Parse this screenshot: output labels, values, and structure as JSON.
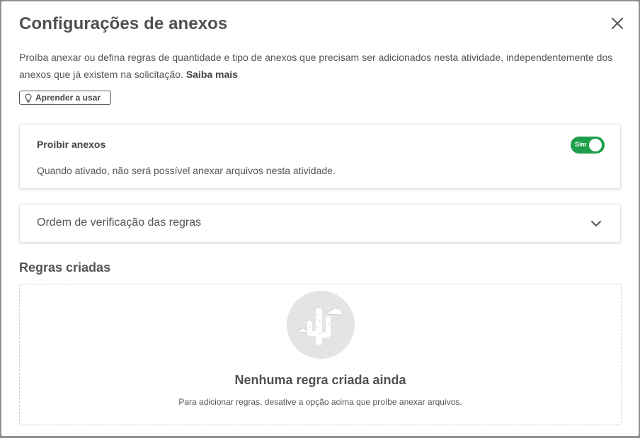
{
  "modal": {
    "title": "Configurações de anexos",
    "description": "Proíba anexar ou defina regras de quantidade e tipo de anexos que precisam ser adicionados nesta atividade, independentemente dos anexos que já existem na solicitação.",
    "learn_more_link": "Saiba mais",
    "learn_button_label": "Aprender a usar",
    "close_icon": "close-icon"
  },
  "prohibit_card": {
    "title": "Proibir anexos",
    "description": "Quando ativado, não será possível anexar arquivos nesta atividade.",
    "toggle_label": "Sim",
    "toggle_on": true,
    "toggle_color": "#1e9e4a"
  },
  "order_card": {
    "title": "Ordem de verificação das regras",
    "icon": "chevron-down-icon"
  },
  "rules_section": {
    "title": "Regras criadas",
    "empty_title": "Nenhuma regra criada ainda",
    "empty_description": "Para adicionar regras, desative a opção acima que proíbe anexar arquivos.",
    "illustration": "cactus-icon"
  }
}
